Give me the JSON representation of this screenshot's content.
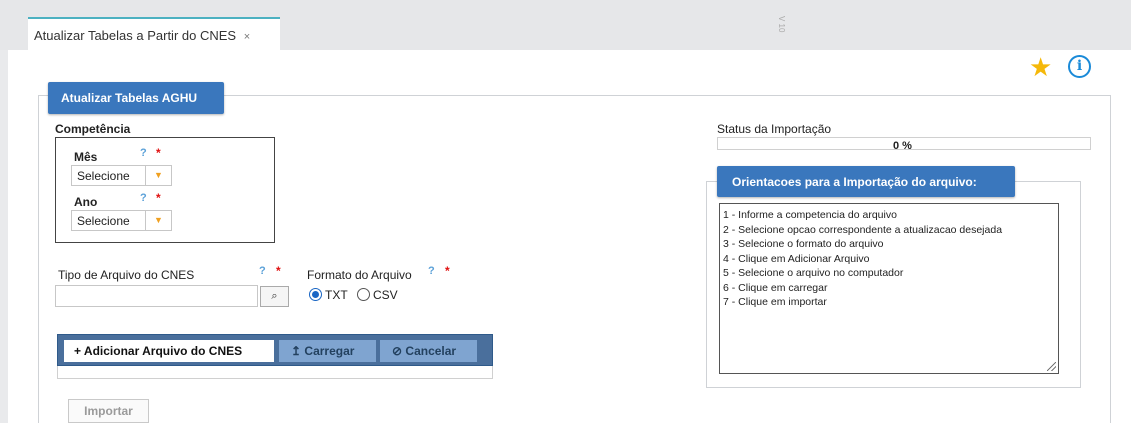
{
  "tab": {
    "title": "Atualizar Tabelas a Partir do CNES",
    "close": "×"
  },
  "version": "V 10",
  "panel": {
    "legend": "Atualizar Tabelas AGHU"
  },
  "competencia": {
    "label": "Competência",
    "mes": {
      "label": "Mês",
      "help": "?",
      "required": "*",
      "value": "Selecione"
    },
    "ano": {
      "label": "Ano",
      "help": "?",
      "required": "*",
      "value": "Selecione"
    }
  },
  "tipo_arquivo": {
    "label": "Tipo de Arquivo do CNES",
    "help": "?",
    "required": "*",
    "value": ""
  },
  "formato": {
    "label": "Formato do Arquivo",
    "help": "?",
    "required": "*",
    "options": [
      "TXT",
      "CSV"
    ],
    "selected": "TXT"
  },
  "upload": {
    "add_label": "Adicionar Arquivo do CNES",
    "add_icon": "+",
    "carregar_label": "Carregar",
    "carregar_icon": "↥",
    "cancelar_label": "Cancelar",
    "cancelar_icon": "⊘"
  },
  "importar_label": "Importar",
  "status": {
    "label": "Status da Importação",
    "progress_text": "0 %",
    "progress": 0
  },
  "orientacoes": {
    "legend": "Orientacoes para a Importação do arquivo:",
    "lines": [
      "1 - Informe a competencia do arquivo",
      "2 - Selecione opcao correspondente a atualizacao desejada",
      "3 - Selecione o formato do arquivo",
      "4 - Clique em Adicionar Arquivo",
      "5 - Selecione o arquivo no computador",
      "6 - Clique em carregar",
      "7 - Clique em importar"
    ]
  },
  "icons": {
    "favorite": "star-icon",
    "info": "info-icon",
    "search": "search-icon",
    "dropdown": "caret-down-icon"
  },
  "colors": {
    "accent": "#3a77bd",
    "star": "#f5b80a",
    "info": "#1a8ad8",
    "required": "#e01010",
    "tab_border": "#4cb1c1"
  }
}
